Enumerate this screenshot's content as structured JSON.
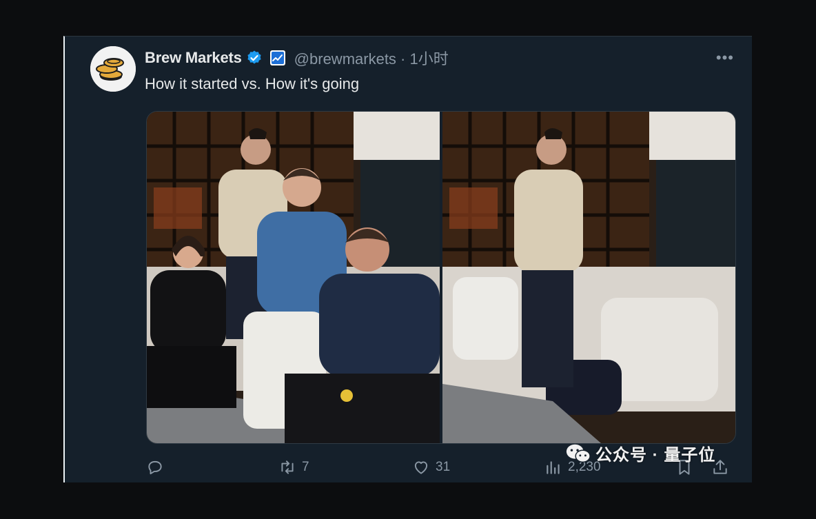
{
  "tweet": {
    "author_name": "Brew Markets",
    "handle_time": "@brewmarkets · 1小时",
    "text": "How it started vs. How it's going",
    "more_label": "•••"
  },
  "media": [
    {
      "name": "photo-started",
      "people_shown": 4
    },
    {
      "name": "photo-going",
      "people_shown": 1
    }
  ],
  "actions": {
    "reply_count": "",
    "retweet_count": "7",
    "like_count": "31",
    "view_count": "2,230"
  },
  "watermark": "公众号 · 量子位",
  "colors": {
    "background": "#15202b",
    "text_primary": "#e7e9ea",
    "text_secondary": "#8b98a5",
    "verified_blue": "#1d9bf0"
  },
  "icons": [
    "verified-badge-icon",
    "affiliate-badge-icon",
    "more-icon",
    "reply-icon",
    "retweet-icon",
    "like-icon",
    "views-icon",
    "bookmark-icon",
    "share-icon",
    "wechat-icon"
  ]
}
